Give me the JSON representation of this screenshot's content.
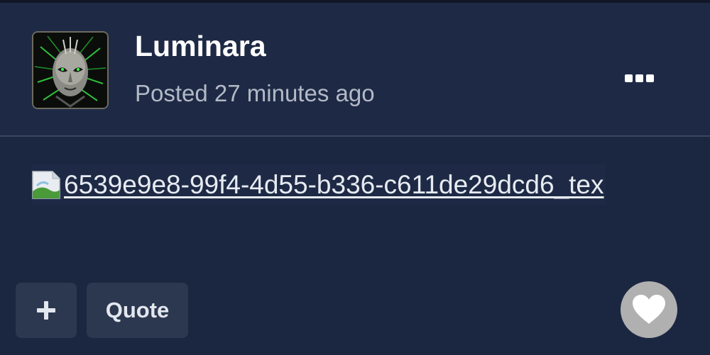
{
  "post": {
    "author": "Luminara",
    "posted_time": "Posted 27 minutes ago",
    "attachment_name": "6539e9e8-99f4-4d55-b336-c611de29dcd6_tex"
  },
  "actions": {
    "quote_label": "Quote"
  },
  "icons": {
    "avatar": "avatar-image",
    "more": "ellipsis-icon",
    "attachment": "broken-image-icon",
    "add": "plus-icon",
    "like": "heart-icon"
  },
  "colors": {
    "background": "#1b2740",
    "header_background": "#1e2a45",
    "button_background": "#2c3850",
    "like_button": "#b0b0b0",
    "text_primary": "#ffffff",
    "text_secondary": "#b3b9c6"
  }
}
